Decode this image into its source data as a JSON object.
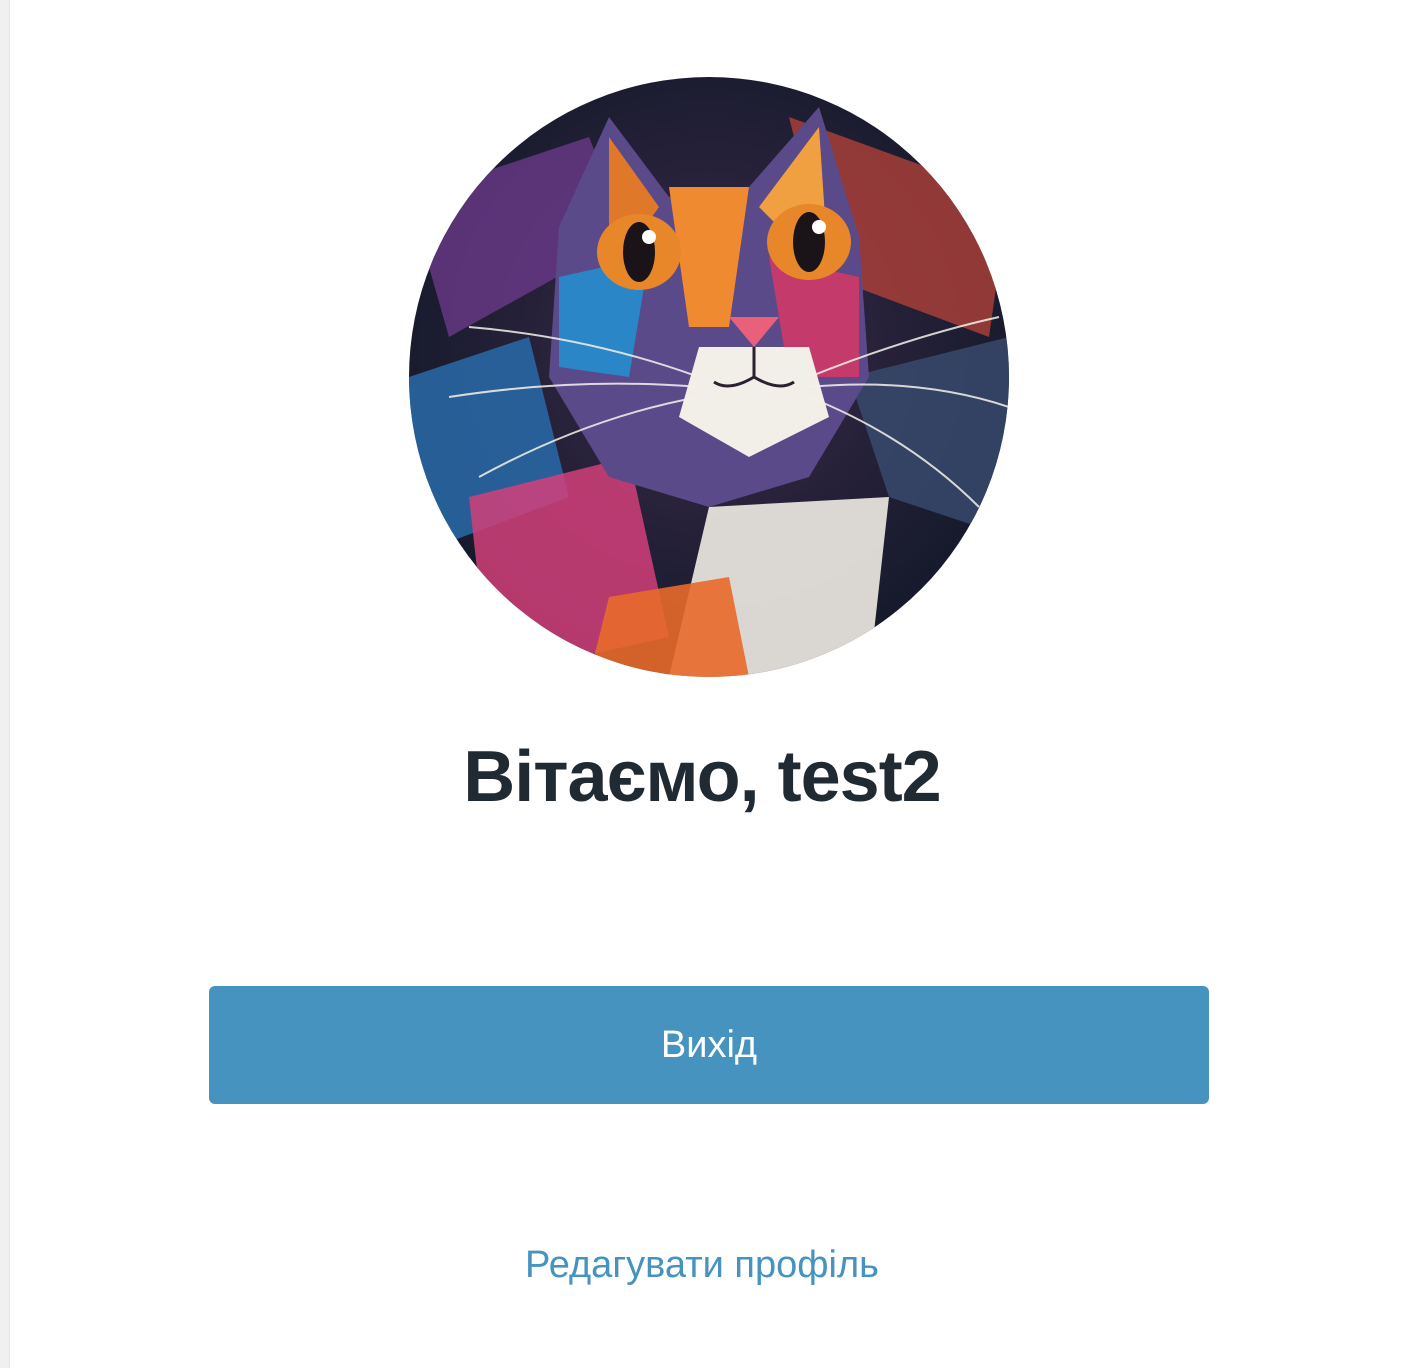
{
  "profile": {
    "greeting": "Вітаємо, test2",
    "logout_label": "Вихід",
    "edit_profile_label": "Редагувати профіль"
  },
  "colors": {
    "accent": "#4593be",
    "heading": "#1f2a33",
    "link": "#4593be"
  },
  "avatar": {
    "icon": "cat-portrait-avatar"
  }
}
